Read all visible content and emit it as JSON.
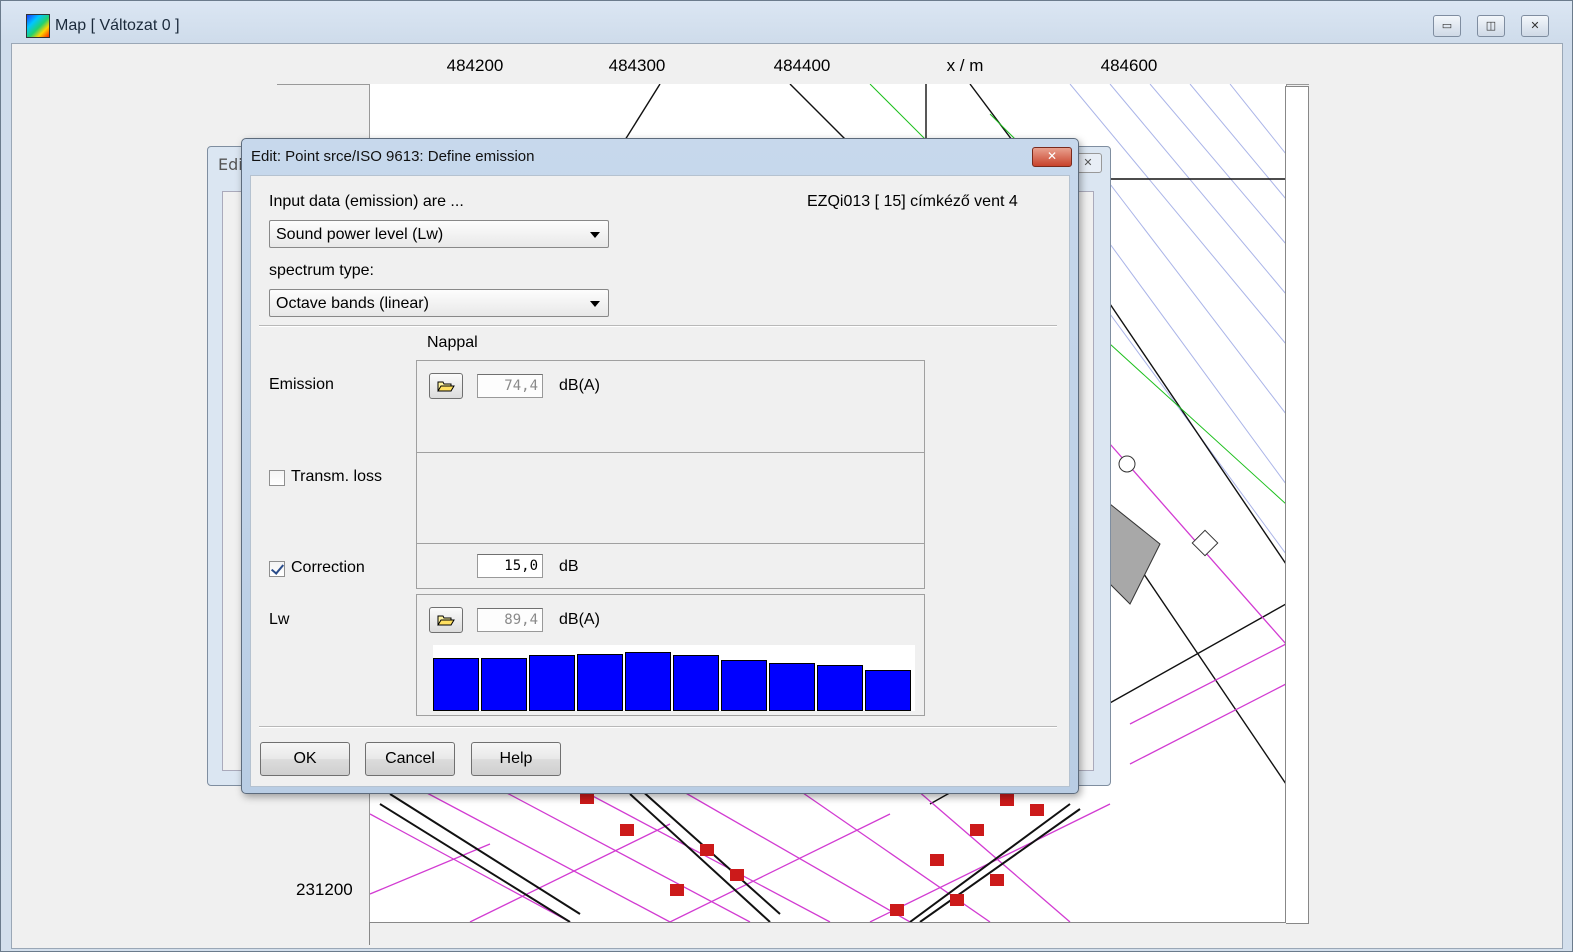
{
  "window": {
    "title": "Map  [ Változat 0 ]",
    "minimize": "▭",
    "maximize": "◫",
    "close": "✕"
  },
  "ruler": {
    "x_ticks": [
      "484200",
      "484300",
      "484400",
      "x / m",
      "484600"
    ],
    "y_label": "231200"
  },
  "background_dialog": {
    "title": "Edi",
    "close": "✕"
  },
  "dialog": {
    "title": "Edit:  Point srce/ISO 9613:  Define emission",
    "close": "✕",
    "input_label": "Input data (emission) are ...",
    "source_id": "EZQi013 [ 15]   címkéző vent 4",
    "input_select": "Sound power level (Lw)",
    "spectrum_label": "spectrum type:",
    "spectrum_select": "Octave bands (linear)",
    "column_header": "Nappal",
    "emission": {
      "label": "Emission",
      "value": "74,4",
      "unit": "dB(A)"
    },
    "transm_loss": {
      "label": "Transm. loss",
      "checked": false
    },
    "correction": {
      "label": "Correction",
      "checked": true,
      "value": "15,0",
      "unit": "dB"
    },
    "lw": {
      "label": "Lw",
      "value": "89,4",
      "unit": "dB(A)"
    },
    "spectrum_levels": [
      0.8,
      0.8,
      0.85,
      0.87,
      0.9,
      0.85,
      0.78,
      0.73,
      0.69,
      0.62
    ],
    "buttons": {
      "ok": "OK",
      "cancel": "Cancel",
      "help": "Help"
    }
  }
}
